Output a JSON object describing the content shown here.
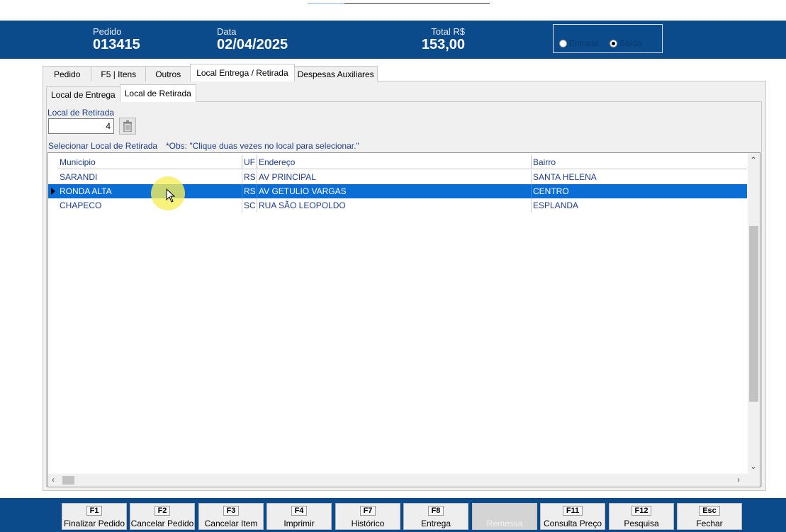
{
  "header": {
    "pedido_label": "Pedido",
    "pedido_value": "013415",
    "data_label": "Data",
    "data_value": "02/04/2025",
    "total_label": "Total R$",
    "total_value": "153,00",
    "radio_entrada": "Entrada",
    "radio_saida": "Saída",
    "radio_selected": "Saída"
  },
  "tabs": [
    "Pedido",
    "F5 | Itens",
    "Outros",
    "Local Entrega  / Retirada",
    "Despesas Auxiliares"
  ],
  "subtabs": [
    "Local de Entrega",
    "Local de Retirada"
  ],
  "form": {
    "local_retirada_label": "Local de Retirada",
    "local_retirada_value": "4",
    "selecionar_label": "Selecionar Local de Retirada",
    "obs": "*Obs: \"Clique duas vezes no local para selecionar.\""
  },
  "grid": {
    "columns": [
      "Municipio",
      "UF",
      "Endereço",
      "Bairro"
    ],
    "rows": [
      [
        "SARANDI",
        "RS",
        "AV PRINCIPAL",
        "SANTA HELENA"
      ],
      [
        "RONDA ALTA",
        "RS",
        "AV GETULIO VARGAS",
        "CENTRO"
      ],
      [
        "CHAPECO",
        "SC",
        "RUA SÃO LEOPOLDO",
        "ESPLANDA"
      ]
    ],
    "selected_row": 1
  },
  "footer": [
    {
      "key": "F1",
      "label": "Finalizar Pedido"
    },
    {
      "key": "F2",
      "label": "Cancelar Pedido"
    },
    {
      "key": "F3",
      "label": "Cancelar Item"
    },
    {
      "key": "F4",
      "label": "Imprimir"
    },
    {
      "key": "F7",
      "label": "Histórico"
    },
    {
      "key": "F8",
      "label": "Entrega"
    },
    {
      "key": "",
      "label": "Remessa"
    },
    {
      "key": "F11",
      "label": "Consulta Preço"
    },
    {
      "key": "F12",
      "label": "Pesquisa"
    },
    {
      "key": "Esc",
      "label": "Fechar"
    }
  ],
  "colors": {
    "brand": "#0b4a8b",
    "selection": "#0a6ed4",
    "text": "#1e3d8a"
  }
}
